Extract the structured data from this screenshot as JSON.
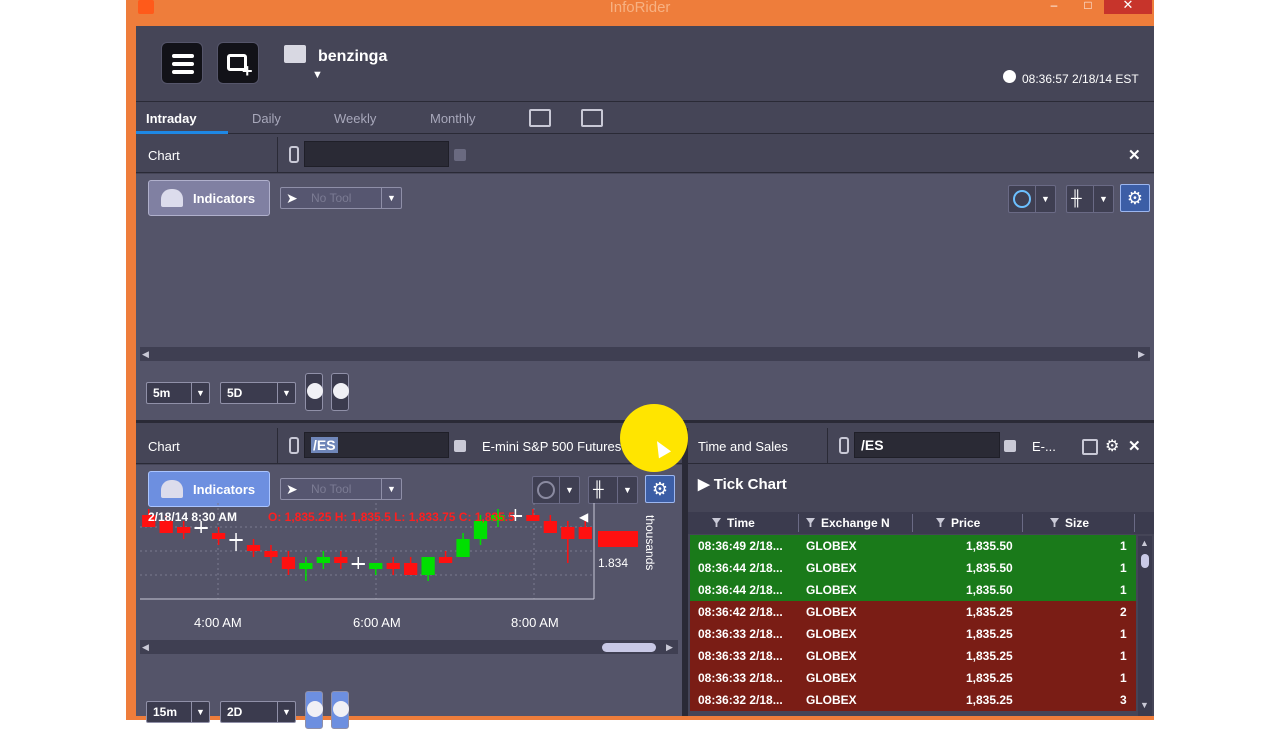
{
  "window": {
    "title": "InfoRider",
    "min": "–",
    "max": "□",
    "close": "✕"
  },
  "header": {
    "user": "benzinga",
    "clock": "08:36:57 2/18/14 EST"
  },
  "tabs": [
    "Intraday",
    "Daily",
    "Weekly",
    "Monthly"
  ],
  "chart1": {
    "title": "Chart",
    "symbol": "",
    "indicators": "Indicators",
    "tool_placeholder": "No Tool",
    "interval": "5m",
    "range": "5D"
  },
  "chart2": {
    "title": "Chart",
    "symbol": "/ES",
    "description": "E-mini S&P 500 Futures",
    "indicators": "Indicators",
    "tool_placeholder": "No Tool",
    "date_time": "2/18/14  8:30 AM",
    "ohlc": "O: 1,835.25  H: 1,835.5  L: 1,833.75  C: 1,835.5",
    "price_label": "1.834",
    "axis_unit": "thousands",
    "time_labels": [
      "4:00 AM",
      "6:00 AM",
      "8:00 AM"
    ],
    "interval": "15m",
    "range": "2D"
  },
  "tns": {
    "title": "Time and Sales",
    "symbol": "/ES",
    "description": "E-...",
    "tick_chart": "▶ Tick Chart",
    "columns": [
      "Time",
      "Exchange N",
      "Price",
      "Size"
    ],
    "rows": [
      {
        "time": "08:36:49 2/18...",
        "exchange": "GLOBEX",
        "price": "1,835.50",
        "size": "1",
        "dir": "up"
      },
      {
        "time": "08:36:44 2/18...",
        "exchange": "GLOBEX",
        "price": "1,835.50",
        "size": "1",
        "dir": "up"
      },
      {
        "time": "08:36:44 2/18...",
        "exchange": "GLOBEX",
        "price": "1,835.50",
        "size": "1",
        "dir": "up"
      },
      {
        "time": "08:36:42 2/18...",
        "exchange": "GLOBEX",
        "price": "1,835.25",
        "size": "2",
        "dir": "down"
      },
      {
        "time": "08:36:33 2/18...",
        "exchange": "GLOBEX",
        "price": "1,835.25",
        "size": "1",
        "dir": "down"
      },
      {
        "time": "08:36:33 2/18...",
        "exchange": "GLOBEX",
        "price": "1,835.25",
        "size": "1",
        "dir": "down"
      },
      {
        "time": "08:36:33 2/18...",
        "exchange": "GLOBEX",
        "price": "1,835.25",
        "size": "1",
        "dir": "down"
      },
      {
        "time": "08:36:32 2/18...",
        "exchange": "GLOBEX",
        "price": "1,835.25",
        "size": "3",
        "dir": "down"
      }
    ]
  },
  "colors": {
    "up": "#00e000",
    "down": "#ff1010",
    "accent": "#1e88e5"
  },
  "candles": [
    {
      "o": 1835.5,
      "h": 1835.75,
      "l": 1835.0,
      "c": 1835.0
    },
    {
      "o": 1835.25,
      "h": 1835.5,
      "l": 1834.75,
      "c": 1834.75
    },
    {
      "o": 1835.0,
      "h": 1835.25,
      "l": 1834.5,
      "c": 1834.75
    },
    {
      "o": 1835.0,
      "h": 1835.25,
      "l": 1834.75,
      "c": 1835.0
    },
    {
      "o": 1834.75,
      "h": 1835.0,
      "l": 1834.25,
      "c": 1834.5
    },
    {
      "o": 1834.5,
      "h": 1834.75,
      "l": 1834.0,
      "c": 1834.5
    },
    {
      "o": 1834.25,
      "h": 1834.5,
      "l": 1833.75,
      "c": 1834.0
    },
    {
      "o": 1834.0,
      "h": 1834.25,
      "l": 1833.5,
      "c": 1833.75
    },
    {
      "o": 1833.75,
      "h": 1834.0,
      "l": 1833.0,
      "c": 1833.25
    },
    {
      "o": 1833.25,
      "h": 1833.75,
      "l": 1832.75,
      "c": 1833.5
    },
    {
      "o": 1833.5,
      "h": 1834.0,
      "l": 1833.25,
      "c": 1833.75
    },
    {
      "o": 1833.75,
      "h": 1834.0,
      "l": 1833.25,
      "c": 1833.5
    },
    {
      "o": 1833.5,
      "h": 1833.75,
      "l": 1833.25,
      "c": 1833.5
    },
    {
      "o": 1833.25,
      "h": 1833.5,
      "l": 1833.0,
      "c": 1833.5
    },
    {
      "o": 1833.5,
      "h": 1833.75,
      "l": 1833.0,
      "c": 1833.25
    },
    {
      "o": 1833.5,
      "h": 1833.75,
      "l": 1833.0,
      "c": 1833.0
    },
    {
      "o": 1833.0,
      "h": 1833.75,
      "l": 1832.75,
      "c": 1833.75
    },
    {
      "o": 1833.75,
      "h": 1834.0,
      "l": 1833.5,
      "c": 1833.5
    },
    {
      "o": 1833.75,
      "h": 1834.75,
      "l": 1833.75,
      "c": 1834.5
    },
    {
      "o": 1834.5,
      "h": 1835.5,
      "l": 1834.25,
      "c": 1835.25
    },
    {
      "o": 1835.25,
      "h": 1835.75,
      "l": 1835.0,
      "c": 1835.5
    },
    {
      "o": 1835.5,
      "h": 1835.75,
      "l": 1835.25,
      "c": 1835.5
    },
    {
      "o": 1835.5,
      "h": 1835.75,
      "l": 1835.25,
      "c": 1835.25
    },
    {
      "o": 1835.25,
      "h": 1835.5,
      "l": 1834.75,
      "c": 1834.75
    },
    {
      "o": 1835.0,
      "h": 1835.25,
      "l": 1833.5,
      "c": 1834.5
    },
    {
      "o": 1835.0,
      "h": 1835.25,
      "l": 1834.5,
      "c": 1834.5
    }
  ]
}
